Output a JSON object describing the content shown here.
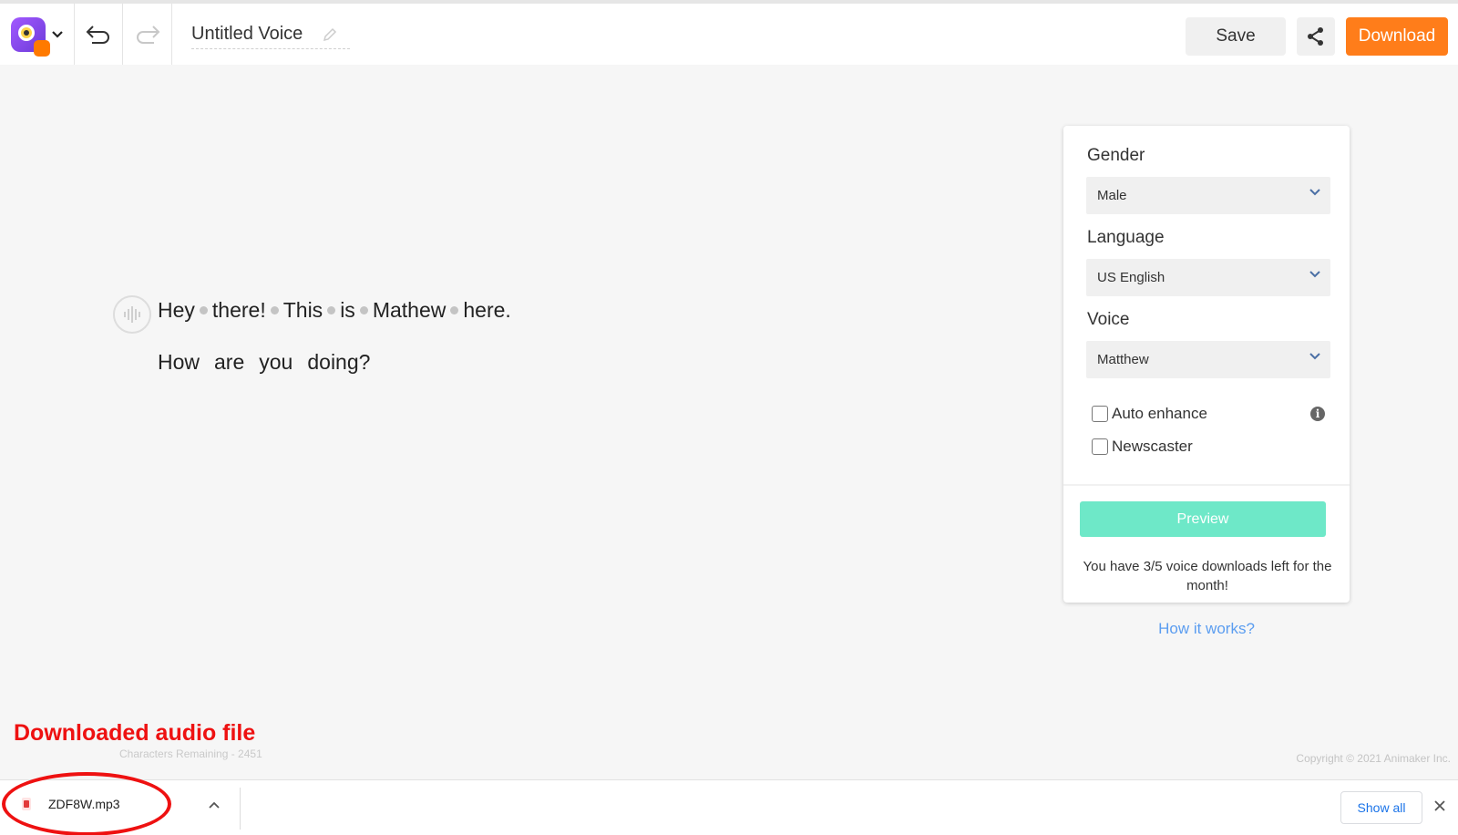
{
  "header": {
    "title": "Untitled Voice",
    "save_label": "Save",
    "download_label": "Download"
  },
  "editor": {
    "line1": [
      "Hey",
      "there!",
      "This",
      "is",
      "Mathew",
      "here."
    ],
    "line2": [
      "How",
      "are",
      "you",
      "doing?"
    ]
  },
  "panel": {
    "gender_label": "Gender",
    "gender_value": "Male",
    "language_label": "Language",
    "language_value": "US English",
    "voice_label": "Voice",
    "voice_value": "Matthew",
    "auto_enhance_label": "Auto enhance",
    "auto_enhance_checked": false,
    "newscaster_label": "Newscaster",
    "newscaster_checked": false,
    "preview_label": "Preview",
    "quota_text": "You have 3/5 voice downloads left for the month!"
  },
  "how_it_works": "How it works?",
  "annotation": "Downloaded audio file",
  "chars_remaining": "Characters Remaining - 2451",
  "copyright": "Copyright © 2021 Animaker Inc.",
  "shelf": {
    "file_name": "ZDF8W.mp3",
    "show_all_label": "Show all"
  },
  "colors": {
    "accent_orange": "#ff7d1a",
    "preview_green": "#6ee8c8",
    "link_blue": "#5b9df0",
    "annotation_red": "#ee1111"
  },
  "icons": [
    "app-logo-icon",
    "chevron-down-icon",
    "undo-icon",
    "redo-icon",
    "pencil-icon",
    "share-icon",
    "voice-wave-icon",
    "info-icon",
    "file-icon",
    "chevron-up-icon",
    "close-icon"
  ]
}
